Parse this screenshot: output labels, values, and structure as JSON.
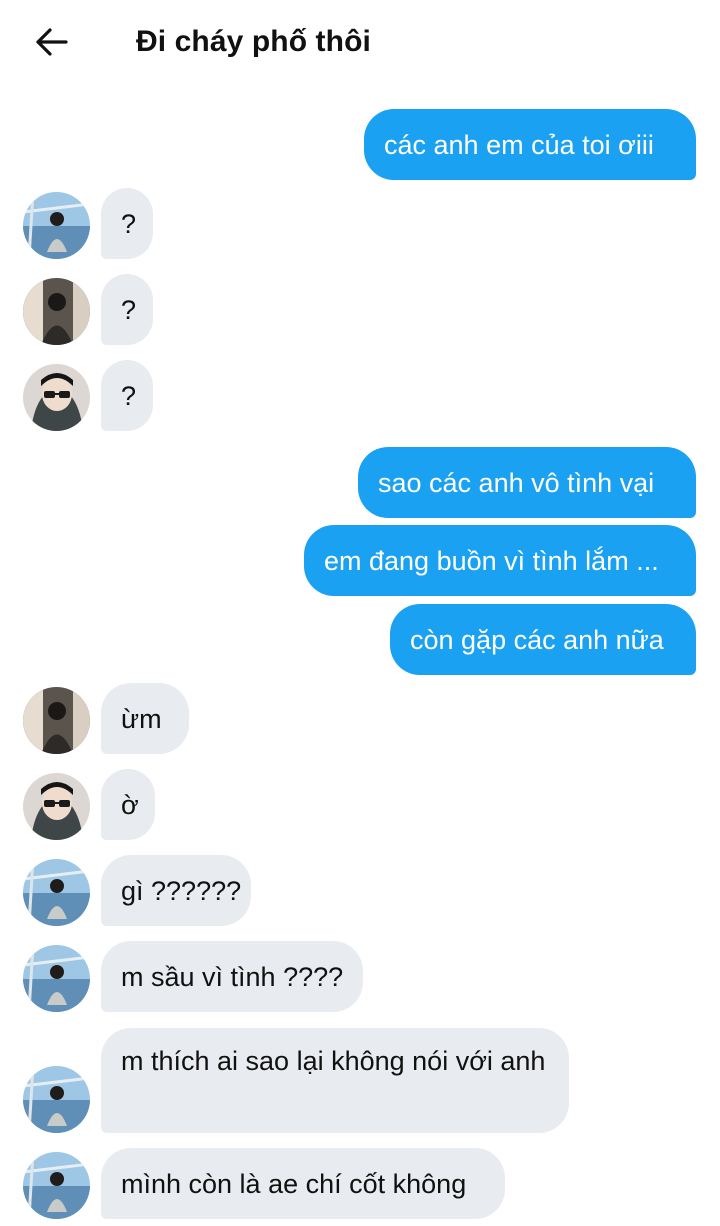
{
  "header": {
    "back_icon": "arrow-left-icon",
    "title": "Đi cháy phố thôi"
  },
  "messages": [
    {
      "dir": "out",
      "text": "các anh em của toi ơiii"
    },
    {
      "dir": "in",
      "avatar": "sea-view-avatar",
      "text": "?"
    },
    {
      "dir": "in",
      "avatar": "dark-room-avatar",
      "text": "?"
    },
    {
      "dir": "in",
      "avatar": "sunglasses-avatar",
      "text": "?"
    },
    {
      "dir": "out",
      "text": "sao các anh vô tình vại"
    },
    {
      "dir": "out",
      "text": "em đang buồn vì tình lắm ..."
    },
    {
      "dir": "out",
      "text": "còn gặp các anh nữa"
    },
    {
      "dir": "in",
      "avatar": "dark-room-avatar",
      "text": "ừm"
    },
    {
      "dir": "in",
      "avatar": "sunglasses-avatar",
      "text": "ờ"
    },
    {
      "dir": "in",
      "avatar": "sea-view-avatar",
      "text": "gì ??????"
    },
    {
      "dir": "in",
      "avatar": "sea-view-avatar",
      "text": "m sầu vì tình ????"
    },
    {
      "dir": "in",
      "avatar": "sea-view-avatar",
      "text": "m thích ai sao lại không nói với anh"
    },
    {
      "dir": "in",
      "avatar": "sea-view-avatar",
      "text": "mình còn là ae chí cốt không"
    }
  ],
  "colors": {
    "outgoing_bubble": "#1ba1f2",
    "incoming_bubble": "#e8ebef",
    "text_dark": "#111111"
  }
}
